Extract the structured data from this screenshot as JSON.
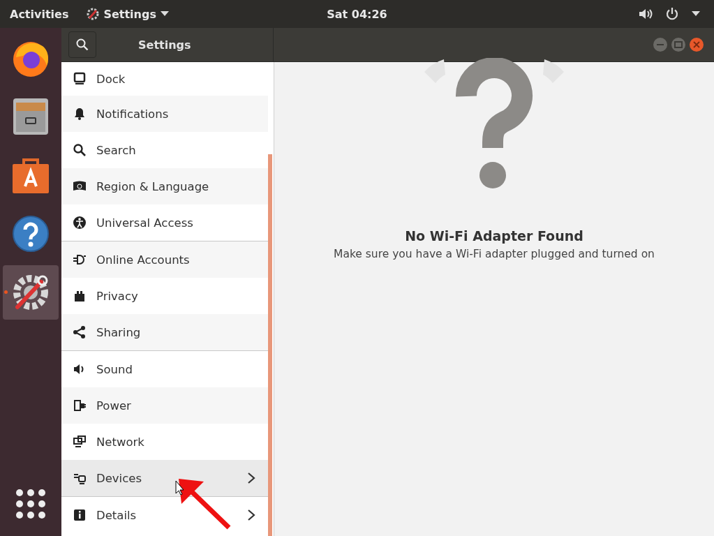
{
  "top_bar": {
    "activities": "Activities",
    "app_menu": "Settings",
    "clock": "Sat 04:26"
  },
  "dock": {
    "items": [
      {
        "selected": false
      },
      {
        "selected": false
      },
      {
        "selected": false
      },
      {
        "selected": false
      },
      {
        "selected": true
      }
    ]
  },
  "window": {
    "title": "Settings"
  },
  "sidebar": {
    "groups": [
      [
        {
          "label": "Dock",
          "hovered": false,
          "submenu": false
        },
        {
          "label": "Notifications",
          "hovered": false,
          "submenu": false
        },
        {
          "label": "Search",
          "hovered": false,
          "submenu": false
        },
        {
          "label": "Region & Language",
          "hovered": false,
          "submenu": false
        },
        {
          "label": "Universal Access",
          "hovered": false,
          "submenu": false
        }
      ],
      [
        {
          "label": "Online Accounts",
          "hovered": false,
          "submenu": false
        },
        {
          "label": "Privacy",
          "hovered": false,
          "submenu": false
        },
        {
          "label": "Sharing",
          "hovered": false,
          "submenu": false
        }
      ],
      [
        {
          "label": "Sound",
          "hovered": false,
          "submenu": false
        },
        {
          "label": "Power",
          "hovered": false,
          "submenu": false
        },
        {
          "label": "Network",
          "hovered": false,
          "submenu": false
        },
        {
          "label": "Devices",
          "hovered": true,
          "submenu": true
        }
      ],
      [
        {
          "label": "Details",
          "hovered": false,
          "submenu": true
        }
      ]
    ]
  },
  "content": {
    "heading": "No Wi-Fi Adapter Found",
    "message": "Make sure you have a Wi-Fi adapter plugged and turned on"
  }
}
